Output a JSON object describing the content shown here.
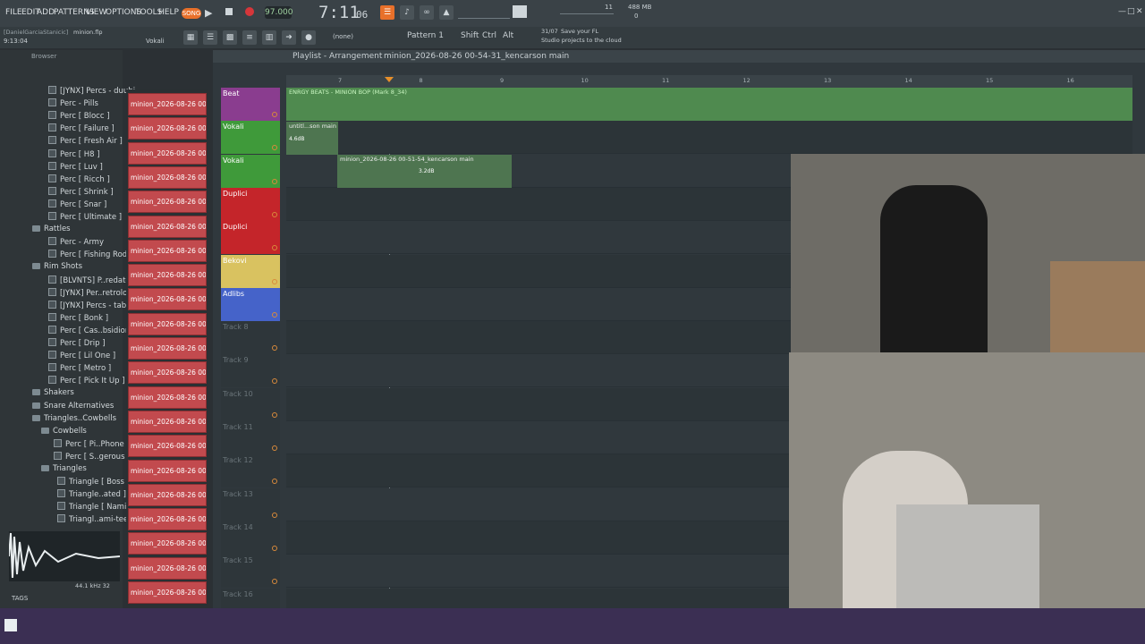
{
  "menu": {
    "items": [
      "FILE",
      "EDIT",
      "ADD",
      "PATTERNS",
      "VIEW",
      "OPTIONS",
      "TOOLS",
      "HELP"
    ]
  },
  "transport": {
    "song_label": "SONG",
    "tempo": "97.000",
    "time": "7:11",
    "time_sub": "06",
    "cpu": "11",
    "memory": "488 MB",
    "voices": "0"
  },
  "project": {
    "user": "[DanielGarciaStanicic]",
    "file": "minion.flp",
    "time": "9:13:04",
    "hint_label": "Vokali"
  },
  "toolbar2": {
    "preset": "(none)",
    "pattern": "Pattern 1",
    "shift": "Shift",
    "ctrl": "Ctrl",
    "alt": "Alt",
    "news_date": "31/07",
    "news_line1": "Save your FL",
    "news_line2": "Studio projects to the cloud"
  },
  "browser": {
    "title": "Browser",
    "items": [
      {
        "label": "[JYNX] Percs - duubi",
        "type": "file"
      },
      {
        "label": "Perc - Pills",
        "type": "file"
      },
      {
        "label": "Perc [ Blocc ]",
        "type": "file"
      },
      {
        "label": "Perc [ Failure ]",
        "type": "file"
      },
      {
        "label": "Perc [ Fresh Air ]",
        "type": "file"
      },
      {
        "label": "Perc [ H8 ]",
        "type": "file"
      },
      {
        "label": "Perc [ Luv ]",
        "type": "file"
      },
      {
        "label": "Perc [ Ricch ]",
        "type": "file"
      },
      {
        "label": "Perc [ Shrink ]",
        "type": "file"
      },
      {
        "label": "Perc [ Snar ]",
        "type": "file"
      },
      {
        "label": "Perc [ Ultimate ]",
        "type": "file"
      },
      {
        "label": "Rattles",
        "type": "folder"
      },
      {
        "label": "Perc - Army",
        "type": "file"
      },
      {
        "label": "Perc [ Fishing Rod ]",
        "type": "file"
      },
      {
        "label": "Rim Shots",
        "type": "folder"
      },
      {
        "label": "[BLVNTS] P..redator",
        "type": "file"
      },
      {
        "label": "[JYNX] Per..retrolog",
        "type": "file"
      },
      {
        "label": "[JYNX] Percs - taboo",
        "type": "file"
      },
      {
        "label": "Perc [ Bonk ]",
        "type": "file"
      },
      {
        "label": "Perc [ Cas..bsidion ]",
        "type": "file"
      },
      {
        "label": "Perc [ Drip ]",
        "type": "file"
      },
      {
        "label": "Perc [ Lil One ]",
        "type": "file"
      },
      {
        "label": "Perc [ Metro ]",
        "type": "file"
      },
      {
        "label": "Perc [ Pick It Up ]",
        "type": "file"
      },
      {
        "label": "Shakers",
        "type": "folder"
      },
      {
        "label": "Snare Alternatives",
        "type": "folder"
      },
      {
        "label": "Triangles..Cowbells",
        "type": "folder"
      },
      {
        "label": "Cowbells",
        "type": "folder"
      },
      {
        "label": "Perc [ Pi..Phone ]",
        "type": "file"
      },
      {
        "label": "Perc [ S..gerous ]",
        "type": "file"
      },
      {
        "label": "Triangles",
        "type": "folder"
      },
      {
        "label": "Triangle [ Boss ]",
        "type": "file"
      },
      {
        "label": "Triangle..ated ]",
        "type": "file"
      },
      {
        "label": "Triangle [ Nami ]",
        "type": "file"
      },
      {
        "label": "Triangl..ami-tee ]",
        "type": "file"
      }
    ],
    "sample_info": "44.1 kHz 32",
    "tags_label": "TAGS"
  },
  "patterns": {
    "item_label": "minion_2026-08-26 00-...",
    "count": 21
  },
  "playlist": {
    "title": "Playlist - Arrangement",
    "clip_name": "minion_2026-08-26 00-54-31_kencarson main",
    "ruler": [
      "7",
      "8",
      "9",
      "10",
      "11",
      "12",
      "13",
      "14",
      "15",
      "16"
    ],
    "tracks": [
      {
        "name": "Beat",
        "color": "#8a3d8f"
      },
      {
        "name": "Vokali",
        "color": "#3f9a3a"
      },
      {
        "name": "Vokali",
        "color": "#3f9a3a"
      },
      {
        "name": "Duplici",
        "color": "#c4252a"
      },
      {
        "name": "Duplici",
        "color": "#c4252a"
      },
      {
        "name": "Bekovi",
        "color": "#d9c260"
      },
      {
        "name": "Adlibs",
        "color": "#4563c9"
      },
      {
        "name": "Track 8",
        "color": ""
      },
      {
        "name": "Track 9",
        "color": ""
      },
      {
        "name": "Track 10",
        "color": ""
      },
      {
        "name": "Track 11",
        "color": ""
      },
      {
        "name": "Track 12",
        "color": ""
      },
      {
        "name": "Track 13",
        "color": ""
      },
      {
        "name": "Track 14",
        "color": ""
      },
      {
        "name": "Track 15",
        "color": ""
      },
      {
        "name": "Track 16",
        "color": ""
      }
    ],
    "clips": {
      "beat": "ENRGY BEATS - MINION BOP (Mark 8_34)",
      "vocal1": "untitl...son main",
      "vocal1_gain": "4.6dB",
      "vocal2": "minion_2026-08-26 00-51-54_kencarson main",
      "vocal2_gain": "3.2dB"
    }
  }
}
